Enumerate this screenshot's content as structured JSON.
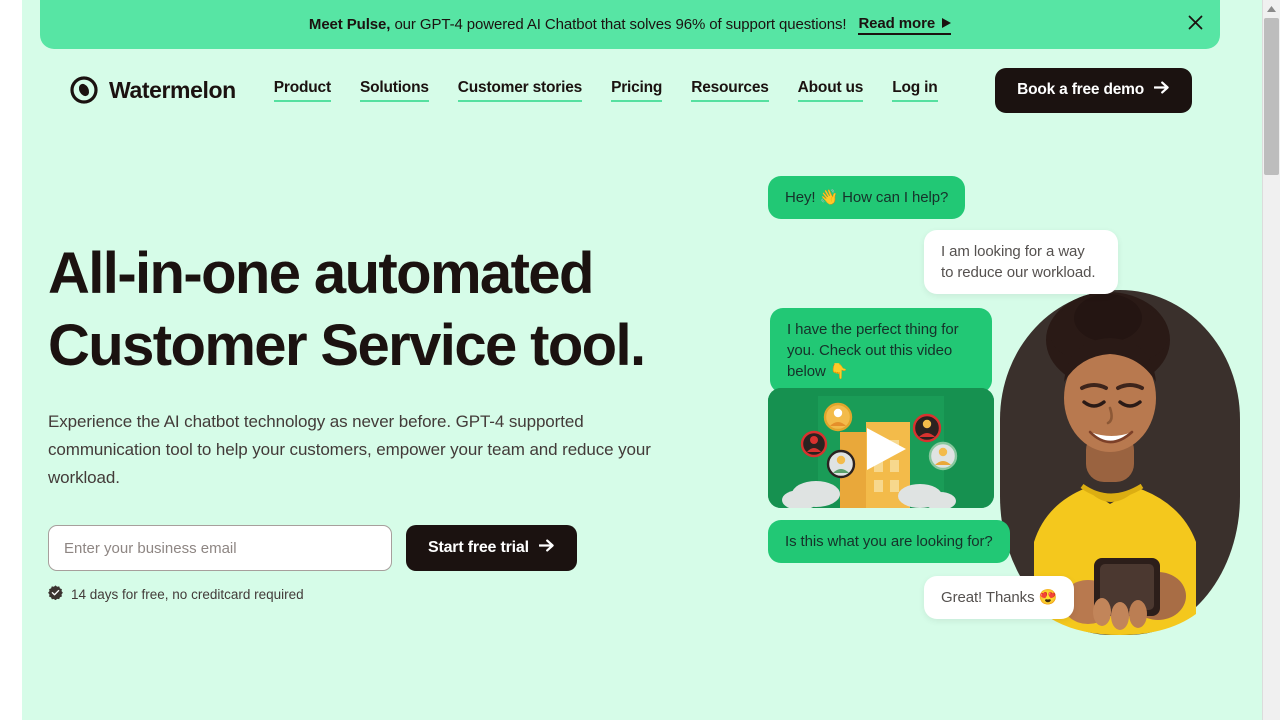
{
  "theme": {
    "page_bg": "#d6fce8",
    "banner_green": "#57e5a4",
    "bubble_green": "#22c875",
    "ink": "#1b1210",
    "underline_green": "#55e0a0",
    "video_green": "#169150",
    "sweater_yellow": "#f4c81d"
  },
  "banner": {
    "strong": "Meet Pulse,",
    "text": "our GPT-4 powered AI Chatbot that solves 96% of support questions!",
    "read_more": "Read more",
    "read_more_arrow": "▶",
    "close_icon": "close-icon"
  },
  "nav": {
    "logo_text": "Watermelon",
    "logo_icon": "watermelon-logo-icon",
    "links": [
      {
        "label": "Product"
      },
      {
        "label": "Solutions"
      },
      {
        "label": "Customer stories"
      },
      {
        "label": "Pricing"
      },
      {
        "label": "Resources"
      },
      {
        "label": "About us"
      },
      {
        "label": "Log in"
      }
    ],
    "cta_label": "Book a free demo",
    "cta_arrow": "➡"
  },
  "hero": {
    "title_line1": "All-in-one automated",
    "title_line2": "Customer Service tool.",
    "subtitle": "Experience the AI chatbot technology as never before. GPT-4 supported communication tool to help your customers, empower your team and reduce your workload.",
    "email_placeholder": "Enter your business email",
    "email_value": "",
    "cta_label": "Start free trial",
    "cta_arrow": "➡",
    "trust_text": "14 days for free, no creditcard required",
    "trust_icon": "verified-badge-icon"
  },
  "chat": {
    "messages": [
      {
        "id": "bubble1",
        "from": "bot",
        "text": "Hey! 👋 How can I help?"
      },
      {
        "id": "bubble2",
        "from": "user",
        "text": "I am looking for a way to reduce our workload."
      },
      {
        "id": "bubble3",
        "from": "bot",
        "text": "I have the perfect thing for you. Check out this video below 👇"
      },
      {
        "id": "bubble4",
        "from": "bot",
        "text": "Is this what you are looking for?"
      },
      {
        "id": "bubble5",
        "from": "user",
        "text": "Great! Thanks 😍"
      }
    ],
    "video_card": {
      "name": "video-thumbnail",
      "play_icon": "play-icon"
    },
    "person_image": "smiling-woman-yellow-sweater-with-phone"
  },
  "scrollbar": {
    "up_arrow": "scroll-up-arrow-icon"
  }
}
